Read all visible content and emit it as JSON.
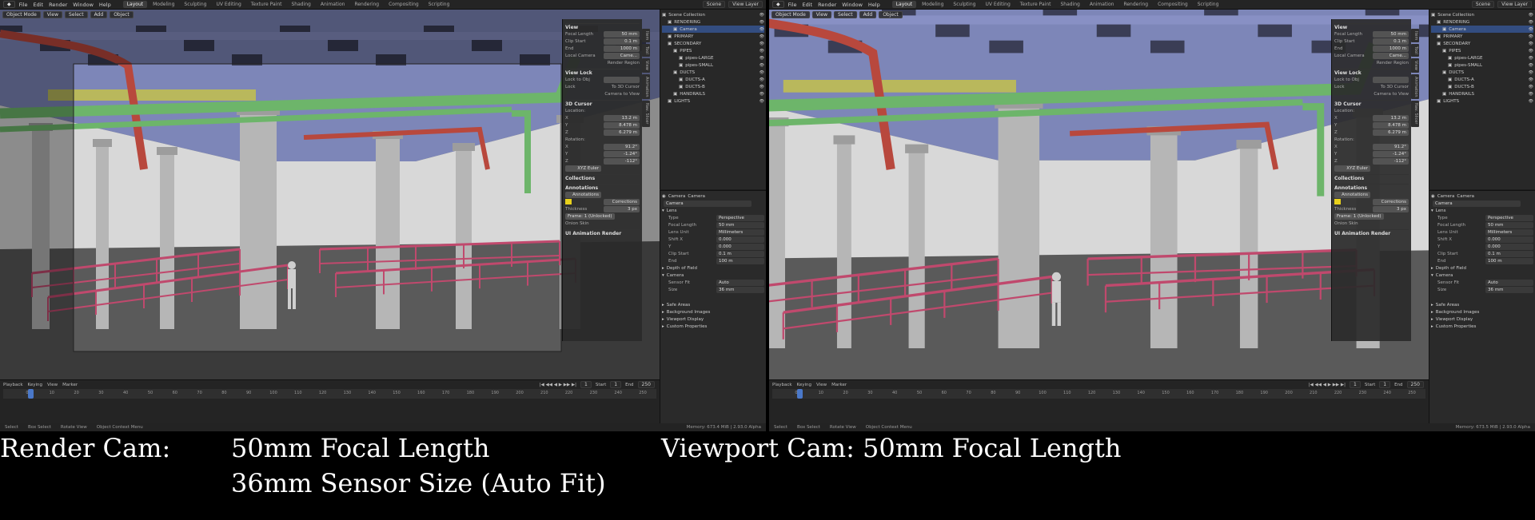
{
  "windows": [
    {
      "menu": [
        "File",
        "Edit",
        "Render",
        "Window",
        "Help"
      ],
      "workspaces": [
        "Layout",
        "Modeling",
        "Sculpting",
        "UV Editing",
        "Texture Paint",
        "Shading",
        "Animation",
        "Rendering",
        "Compositing",
        "Scripting"
      ],
      "scene": "Scene",
      "view_layer": "View Layer",
      "header": {
        "mode": "Object Mode",
        "items": [
          "View",
          "Select",
          "Add",
          "Object"
        ]
      },
      "npanel": {
        "view_title": "View",
        "focal_length_label": "Focal Length",
        "focal_length": "50 mm",
        "clip_start_label": "Clip Start",
        "clip_start": "0.1 m",
        "end_label": "End",
        "end": "1000 m",
        "local_camera": "Local Camera",
        "camera_field": "Came...",
        "render_region": "Render Region",
        "view_lock": "View Lock",
        "lock_to_obj": "Lock to Obj",
        "lock": "Lock",
        "to_3d_cursor": "To 3D Cursor",
        "camera_to_view": "Camera to View",
        "cursor_title": "3D Cursor",
        "location_label": "Location:",
        "loc_x": "13.2 m",
        "loc_y": "8.478 m",
        "loc_z": "6.279 m",
        "rotation_label": "Rotation:",
        "rot_x": "91.2°",
        "rot_y": "-1.24°",
        "rot_z": "-112°",
        "rotation_mode": "XYZ Euler",
        "collections": "Collections",
        "annotations": "Annotations",
        "annotation_layer": "Annotations",
        "corrections": "Corrections",
        "thickness_label": "Thickness",
        "thickness": "3 px",
        "frame_status": "Frame: 1 (Unlocked)",
        "onion_skin": "Onion Skin",
        "ui_anim": "UI Animation Render"
      },
      "vtabs": [
        "Item",
        "Tool",
        "View",
        "Animation",
        "Nav. Slicer"
      ],
      "outliner": [
        {
          "label": "Scene Collection",
          "indent": 0,
          "sel": false
        },
        {
          "label": "RENDERING",
          "indent": 1,
          "sel": false
        },
        {
          "label": "Camera",
          "indent": 2,
          "sel": true
        },
        {
          "label": "PRIMARY",
          "indent": 1,
          "sel": false
        },
        {
          "label": "SECONDARY",
          "indent": 1,
          "sel": false
        },
        {
          "label": "PIPES",
          "indent": 2,
          "sel": false
        },
        {
          "label": "pipes-LARGE",
          "indent": 3,
          "sel": false
        },
        {
          "label": "pipes-SMALL",
          "indent": 3,
          "sel": false
        },
        {
          "label": "DUCTS",
          "indent": 2,
          "sel": false
        },
        {
          "label": "DUCTS-A",
          "indent": 3,
          "sel": false
        },
        {
          "label": "DUCTS-B",
          "indent": 3,
          "sel": false
        },
        {
          "label": "HANDRAILS",
          "indent": 2,
          "sel": false
        },
        {
          "label": "LIGHTS",
          "indent": 1,
          "sel": false
        }
      ],
      "props": {
        "crumb_a": "Camera",
        "crumb_b": "Camera",
        "name": "Camera",
        "lens": "Lens",
        "type_label": "Type",
        "type": "Perspective",
        "focal_label": "Focal Length",
        "focal": "50 mm",
        "lens_unit_label": "Lens Unit",
        "lens_unit": "Millimeters",
        "shift_x_label": "Shift X",
        "shift_x": "0.000",
        "shift_y_label": "Y",
        "shift_y": "0.000",
        "clip_start_label": "Clip Start",
        "clip_start": "0.1 m",
        "clip_end_label": "End",
        "clip_end": "100 m",
        "dof": "Depth of Field",
        "camera": "Camera",
        "sensor_fit_label": "Sensor Fit",
        "sensor_fit": "Auto",
        "size_label": "Size",
        "size": "36 mm",
        "safe_areas": "Safe Areas",
        "bg_images": "Background Images",
        "viewport_display": "Viewport Display",
        "custom_props": "Custom Properties"
      },
      "timeline": {
        "items": [
          "Playback",
          "Keying",
          "View",
          "Marker"
        ],
        "frame": "1",
        "start_label": "Start",
        "start": "1",
        "end_label": "End",
        "end": "250",
        "ticks": [
          "0",
          "10",
          "20",
          "30",
          "40",
          "50",
          "60",
          "70",
          "80",
          "90",
          "100",
          "110",
          "120",
          "130",
          "140",
          "150",
          "160",
          "170",
          "180",
          "190",
          "200",
          "210",
          "220",
          "230",
          "240",
          "250"
        ]
      },
      "status": {
        "select": "Select",
        "box_select": "Box Select",
        "rotate": "Rotate View",
        "context": "Object Context Menu",
        "memory": "Memory: 673.4 MiB | 2.93.0 Alpha"
      },
      "view_mode": "render"
    },
    {
      "menu": [
        "File",
        "Edit",
        "Render",
        "Window",
        "Help"
      ],
      "workspaces": [
        "Layout",
        "Modeling",
        "Sculpting",
        "UV Editing",
        "Texture Paint",
        "Shading",
        "Animation",
        "Rendering",
        "Compositing",
        "Scripting"
      ],
      "scene": "Scene",
      "view_layer": "View Layer",
      "header": {
        "mode": "Object Mode",
        "items": [
          "View",
          "Select",
          "Add",
          "Object"
        ]
      },
      "npanel": {
        "view_title": "View",
        "focal_length_label": "Focal Length",
        "focal_length": "50 mm",
        "clip_start_label": "Clip Start",
        "clip_start": "0.1 m",
        "end_label": "End",
        "end": "1000 m",
        "local_camera": "Local Camera",
        "camera_field": "Came...",
        "render_region": "Render Region",
        "view_lock": "View Lock",
        "lock_to_obj": "Lock to Obj",
        "lock": "Lock",
        "to_3d_cursor": "To 3D Cursor",
        "camera_to_view": "Camera to View",
        "cursor_title": "3D Cursor",
        "location_label": "Location:",
        "loc_x": "13.2 m",
        "loc_y": "8.478 m",
        "loc_z": "6.279 m",
        "rotation_label": "Rotation:",
        "rot_x": "91.2°",
        "rot_y": "-1.24°",
        "rot_z": "-112°",
        "rotation_mode": "XYZ Euler",
        "collections": "Collections",
        "annotations": "Annotations",
        "annotation_layer": "Annotations",
        "corrections": "Corrections",
        "thickness_label": "Thickness",
        "thickness": "3 px",
        "frame_status": "Frame: 1 (Unlocked)",
        "onion_skin": "Onion Skin",
        "ui_anim": "UI Animation Render"
      },
      "vtabs": [
        "Item",
        "Tool",
        "View",
        "Animation",
        "Nav. Slicer"
      ],
      "outliner": [
        {
          "label": "Scene Collection",
          "indent": 0,
          "sel": false
        },
        {
          "label": "RENDERING",
          "indent": 1,
          "sel": false
        },
        {
          "label": "Camera",
          "indent": 2,
          "sel": true
        },
        {
          "label": "PRIMARY",
          "indent": 1,
          "sel": false
        },
        {
          "label": "SECONDARY",
          "indent": 1,
          "sel": false
        },
        {
          "label": "PIPES",
          "indent": 2,
          "sel": false
        },
        {
          "label": "pipes-LARGE",
          "indent": 3,
          "sel": false
        },
        {
          "label": "pipes-SMALL",
          "indent": 3,
          "sel": false
        },
        {
          "label": "DUCTS",
          "indent": 2,
          "sel": false
        },
        {
          "label": "DUCTS-A",
          "indent": 3,
          "sel": false
        },
        {
          "label": "DUCTS-B",
          "indent": 3,
          "sel": false
        },
        {
          "label": "HANDRAILS",
          "indent": 2,
          "sel": false
        },
        {
          "label": "LIGHTS",
          "indent": 1,
          "sel": false
        }
      ],
      "props": {
        "crumb_a": "Camera",
        "crumb_b": "Camera",
        "name": "Camera",
        "lens": "Lens",
        "type_label": "Type",
        "type": "Perspective",
        "focal_label": "Focal Length",
        "focal": "50 mm",
        "lens_unit_label": "Lens Unit",
        "lens_unit": "Millimeters",
        "shift_x_label": "Shift X",
        "shift_x": "0.000",
        "shift_y_label": "Y",
        "shift_y": "0.000",
        "clip_start_label": "Clip Start",
        "clip_start": "0.1 m",
        "clip_end_label": "End",
        "clip_end": "100 m",
        "dof": "Depth of Field",
        "camera": "Camera",
        "sensor_fit_label": "Sensor Fit",
        "sensor_fit": "Auto",
        "size_label": "Size",
        "size": "36 mm",
        "safe_areas": "Safe Areas",
        "bg_images": "Background Images",
        "viewport_display": "Viewport Display",
        "custom_props": "Custom Properties"
      },
      "timeline": {
        "items": [
          "Playback",
          "Keying",
          "View",
          "Marker"
        ],
        "frame": "1",
        "start_label": "Start",
        "start": "1",
        "end_label": "End",
        "end": "250",
        "ticks": [
          "0",
          "10",
          "20",
          "30",
          "40",
          "50",
          "60",
          "70",
          "80",
          "90",
          "100",
          "110",
          "120",
          "130",
          "140",
          "150",
          "160",
          "170",
          "180",
          "190",
          "200",
          "210",
          "220",
          "230",
          "240",
          "250"
        ]
      },
      "status": {
        "select": "Select",
        "box_select": "Box Select",
        "rotate": "Rotate View",
        "context": "Object Context Menu",
        "memory": "Memory: 673.5 MiB | 2.93.0 Alpha"
      },
      "view_mode": "viewport"
    }
  ],
  "captions": {
    "render_label": "Render Cam:",
    "render_line1": "50mm Focal Length",
    "render_line2": "36mm Sensor Size (Auto Fit)",
    "viewport_line": "Viewport Cam: 50mm Focal Length"
  },
  "colors": {
    "ceiling": "#7d86b8",
    "pipe_red": "#b8483d",
    "pipe_green": "#6db56a",
    "duct_yellow": "#b9b85c",
    "handrail": "#c0496d",
    "floor": "#5a5a5a",
    "column": "#b6b6b6"
  }
}
